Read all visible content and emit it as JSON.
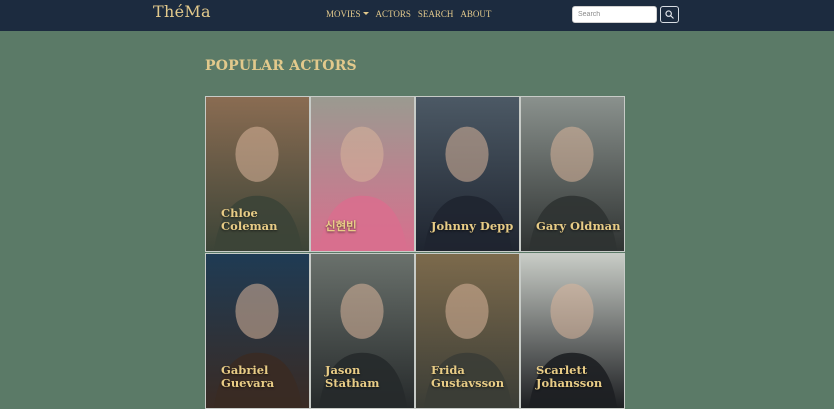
{
  "navbar": {
    "brand": "ThéMa",
    "links": [
      {
        "label": "MOVIES",
        "dropdown": true
      },
      {
        "label": "ACTORS"
      },
      {
        "label": "SEARCH"
      },
      {
        "label": "ABOUT"
      }
    ],
    "search": {
      "placeholder": "Search",
      "value": ""
    },
    "search_button_icon": "search-icon"
  },
  "page": {
    "title": "POPULAR ACTORS"
  },
  "actors": [
    {
      "name": "Chloe Coleman",
      "name_lines": [
        "Chloe",
        "Coleman"
      ],
      "colors": [
        "#8a6c52",
        "#3c4437"
      ]
    },
    {
      "name": "신현빈",
      "name_lines": [
        "신현빈"
      ],
      "colors": [
        "#9a9a90",
        "#d86f8e"
      ]
    },
    {
      "name": "Johnny Depp",
      "name_lines": [
        "Johnny Depp"
      ],
      "colors": [
        "#4c5965",
        "#1f2530"
      ]
    },
    {
      "name": "Gary Oldman",
      "name_lines": [
        "Gary Oldman"
      ],
      "colors": [
        "#8a918d",
        "#2f3332"
      ]
    },
    {
      "name": "Gabriel Guevara",
      "name_lines": [
        "Gabriel",
        "Guevara"
      ],
      "colors": [
        "#1f3b54",
        "#3a2b24"
      ]
    },
    {
      "name": "Jason Statham",
      "name_lines": [
        "Jason Statham"
      ],
      "colors": [
        "#6a716c",
        "#262a2b"
      ]
    },
    {
      "name": "Frida Gustavsson",
      "name_lines": [
        "Frida",
        "Gustavsson"
      ],
      "colors": [
        "#7c6a4c",
        "#3b3d36"
      ]
    },
    {
      "name": "Scarlett Johansson",
      "name_lines": [
        "Scarlett",
        "Johansson"
      ],
      "colors": [
        "#c8ccc6",
        "#1d1f22"
      ]
    }
  ]
}
